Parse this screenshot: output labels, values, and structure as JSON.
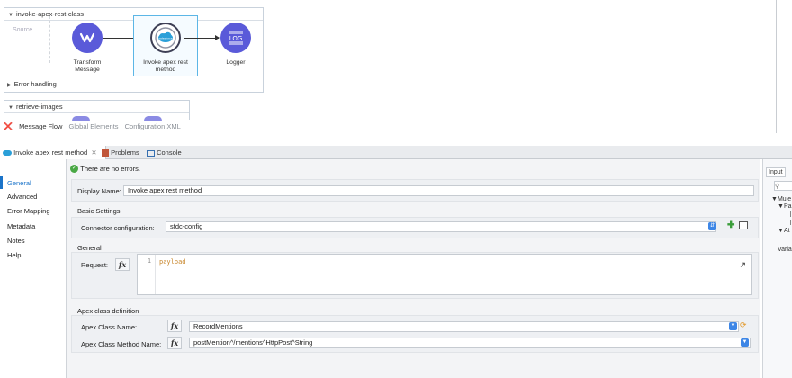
{
  "canvas": {
    "flow1": {
      "name": "invoke-apex-rest-class",
      "source_label": "Source",
      "nodes": [
        {
          "label_line1": "Transform",
          "label_line2": "Message",
          "icon": "transform-icon"
        },
        {
          "label_line1": "Invoke apex rest",
          "label_line2": "method",
          "icon": "salesforce-icon"
        },
        {
          "label_line1": "Logger",
          "label_line2": "",
          "icon": "logger-icon"
        }
      ],
      "error_handling": "Error handling"
    },
    "flow2": {
      "name": "retrieve-images"
    },
    "view_tabs": [
      "Message Flow",
      "Global Elements",
      "Configuration XML"
    ]
  },
  "editor_tabs": [
    "Invoke apex rest method",
    "Problems",
    "Console"
  ],
  "nav": [
    "General",
    "Advanced",
    "Error Mapping",
    "Metadata",
    "Notes",
    "Help"
  ],
  "status": "There are no errors.",
  "form": {
    "display_name_label": "Display Name:",
    "display_name_value": "Invoke apex rest method",
    "basic_settings_title": "Basic Settings",
    "connector_label": "Connector configuration:",
    "connector_value": "sfdc-config",
    "general_title": "General",
    "request_label": "Request:",
    "code_line_number": "1",
    "code_text": "payload",
    "apex_title": "Apex class definition",
    "apex_class_label": "Apex Class Name:",
    "apex_class_value": "RecordMentions",
    "apex_method_label": "Apex Class Method Name:",
    "apex_method_value": "postMention^/mentions^HttpPost^String",
    "fx_label": "fx"
  },
  "right_panel": {
    "tab": "Input",
    "tree": [
      "Mule",
      "Pa",
      "At"
    ],
    "vars": "Varia"
  },
  "colors": {
    "node": "#5a5ad9",
    "accent": "#1a73c9",
    "selection": "#5cb6e6"
  }
}
